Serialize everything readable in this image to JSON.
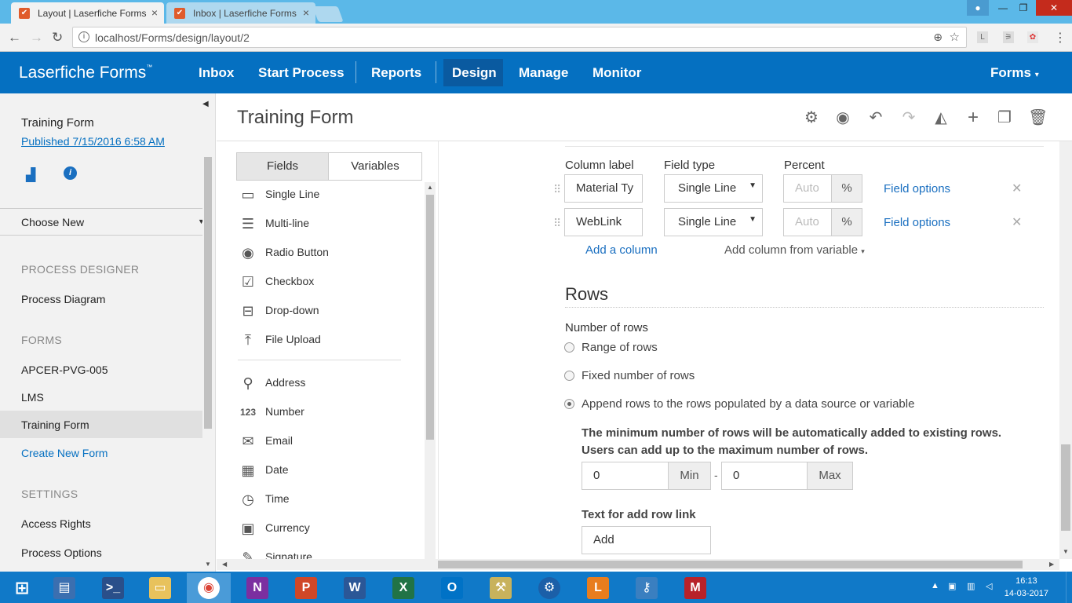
{
  "browser": {
    "tabs": [
      {
        "title": "Layout | Laserfiche Forms",
        "active": true
      },
      {
        "title": "Inbox | Laserfiche Forms",
        "active": false
      }
    ],
    "url": "localhost/Forms/design/layout/2"
  },
  "app": {
    "brand": "Laserfiche Forms",
    "brand_mark": "™",
    "nav": [
      "Inbox",
      "Start Process",
      "Reports",
      "Design",
      "Manage",
      "Monitor"
    ],
    "active_nav": "Design",
    "user_menu": "Forms",
    "accent_color": "#0570c1"
  },
  "sidebar": {
    "process_name": "Training Form",
    "published": "Published 7/15/2016 6:58 AM",
    "choose_new": "Choose New",
    "section_process": "PROCESS DESIGNER",
    "process_diagram": "Process Diagram",
    "section_forms": "FORMS",
    "forms": [
      "APCER-PVG-005",
      "LMS",
      "Training Form"
    ],
    "selected_form": "Training Form",
    "create_new": "Create New Form",
    "section_settings": "SETTINGS",
    "access_rights": "Access Rights",
    "process_options": "Process Options"
  },
  "main": {
    "title": "Training Form",
    "toolbar_icons": [
      "gear-icon",
      "eye-icon",
      "undo-icon",
      "redo-icon",
      "eraser-icon",
      "plus-icon",
      "copy-icon",
      "trash-icon"
    ]
  },
  "palette": {
    "tabs": [
      "Fields",
      "Variables"
    ],
    "active_tab": "Fields",
    "items": [
      "Single Line",
      "Multi-line",
      "Radio Button",
      "Checkbox",
      "Drop-down",
      "File Upload",
      "Address",
      "Number",
      "Email",
      "Date",
      "Time",
      "Currency",
      "Signature"
    ]
  },
  "props": {
    "col_label_header": "Column label",
    "field_type_header": "Field type",
    "percent_header": "Percent",
    "columns": [
      {
        "label": "Material Ty",
        "type": "Single Line",
        "percent_placeholder": "Auto",
        "percent_unit": "%",
        "options": "Field options"
      },
      {
        "label": "WebLink",
        "type": "Single Line",
        "percent_placeholder": "Auto",
        "percent_unit": "%",
        "options": "Field options"
      }
    ],
    "add_column": "Add a column",
    "add_column_var": "Add column from variable",
    "rows_heading": "Rows",
    "num_rows_label": "Number of rows",
    "row_options": [
      "Range of rows",
      "Fixed number of rows",
      "Append rows to the rows populated by a data source or variable"
    ],
    "selected_row_option": 2,
    "info_line1": "The minimum number of rows will be automatically added to existing rows.",
    "info_line2": "Users can add up to the maximum number of rows.",
    "min_value": "0",
    "min_label": "Min",
    "range_sep": "-",
    "max_value": "0",
    "max_label": "Max",
    "add_row_text_label": "Text for add row link",
    "add_row_text_value": "Add"
  },
  "taskbar": {
    "time": "16:13",
    "date": "14-03-2017"
  }
}
